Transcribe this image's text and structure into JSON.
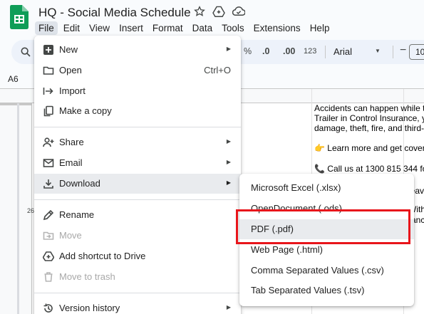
{
  "app": {
    "title": "HQ - Social Media Schedule"
  },
  "menubar": {
    "items": [
      "File",
      "Edit",
      "View",
      "Insert",
      "Format",
      "Data",
      "Tools",
      "Extensions",
      "Help"
    ]
  },
  "toolbar": {
    "percent": "%",
    "dec_decrease": ".0",
    "dec_increase": ".00",
    "number_format": "123",
    "font": "Arial",
    "font_size": "10"
  },
  "namebox": {
    "value": "A6"
  },
  "grid": {
    "row_number": "26",
    "cell_lines": [
      "Accidents can happen while t",
      "Trailer in Control Insurance, y",
      "damage, theft, fire, and third-",
      "",
      "👉 Learn more and get cover",
      "",
      "📞 Call us at 1300 815 344 fo"
    ],
    "cell_line_b1": "leav",
    "cell_line_b2": "With",
    "cell_line_b3": "ranc"
  },
  "file_menu": {
    "items": [
      {
        "label": "New",
        "icon": "plus-box-icon",
        "submenu": true
      },
      {
        "label": "Open",
        "icon": "folder-icon",
        "shortcut": "Ctrl+O"
      },
      {
        "label": "Import",
        "icon": "import-arrow-icon"
      },
      {
        "label": "Make a copy",
        "icon": "copy-icon"
      },
      {
        "label": "Share",
        "icon": "person-add-icon",
        "submenu": true
      },
      {
        "label": "Email",
        "icon": "envelope-icon",
        "submenu": true
      },
      {
        "label": "Download",
        "icon": "download-icon",
        "submenu": true
      },
      {
        "label": "Rename",
        "icon": "pencil-icon"
      },
      {
        "label": "Move",
        "icon": "folder-move-icon",
        "disabled": true
      },
      {
        "label": "Add shortcut to Drive",
        "icon": "drive-shortcut-icon"
      },
      {
        "label": "Move to trash",
        "icon": "trash-icon",
        "disabled": true
      },
      {
        "label": "Version history",
        "icon": "history-icon",
        "submenu": true
      }
    ]
  },
  "download_menu": {
    "items": [
      "Microsoft Excel (.xlsx)",
      "OpenDocument (.ods)",
      "PDF (.pdf)",
      "Web Page (.html)",
      "Comma Separated Values (.csv)",
      "Tab Separated Values (.tsv)"
    ]
  },
  "colors": {
    "sheets_green": "#0f9d58",
    "highlight_red": "#e8151b",
    "menu_hover": "#e9ebee"
  }
}
